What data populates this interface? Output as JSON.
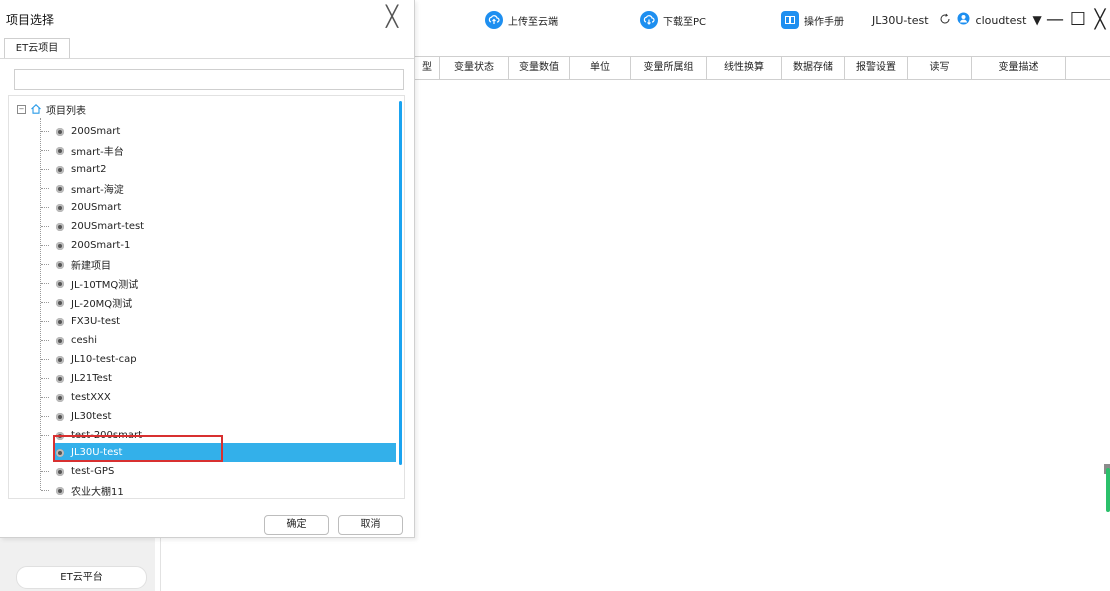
{
  "dialog": {
    "title": "项目选择",
    "close_symbol": "╳",
    "tab_label": "ET云项目",
    "search_value": "",
    "tree_root_label": "项目列表",
    "items": [
      {
        "label": "200Smart"
      },
      {
        "label": "smart-丰台"
      },
      {
        "label": "smart2"
      },
      {
        "label": "smart-海淀"
      },
      {
        "label": "20USmart"
      },
      {
        "label": "20USmart-test"
      },
      {
        "label": "200Smart-1"
      },
      {
        "label": "新建项目"
      },
      {
        "label": "JL-10TMQ测试"
      },
      {
        "label": "JL-20MQ测试"
      },
      {
        "label": "FX3U-test"
      },
      {
        "label": "ceshi"
      },
      {
        "label": "JL10-test-cap"
      },
      {
        "label": "JL21Test"
      },
      {
        "label": "testXXX"
      },
      {
        "label": "JL30test"
      },
      {
        "label": "test-200smart"
      },
      {
        "label": "JL30U-test"
      },
      {
        "label": "test-GPS"
      },
      {
        "label": "农业大棚11"
      }
    ],
    "selected_index": 17,
    "ok_label": "确定",
    "cancel_label": "取消"
  },
  "toolbar": {
    "upload_label": "上传至云端",
    "download_label": "下载至PC",
    "manual_label": "操作手册",
    "current_project": "JL30U-test",
    "username": "cloudtest",
    "user_dropdown_symbol": "▼",
    "minimize_symbol": "—",
    "maximize_symbol": "☐",
    "close_symbol": "╳"
  },
  "table": {
    "columns": [
      "型",
      "变量状态",
      "变量数值",
      "单位",
      "变量所属组",
      "线性换算",
      "数据存储",
      "报警设置",
      "读写",
      "变量描述"
    ]
  },
  "sidebar": {
    "platform_label": "ET云平台"
  },
  "colors": {
    "accent": "#1e8ff0",
    "selection": "#33b0ea",
    "highlight_box": "#d83030"
  }
}
